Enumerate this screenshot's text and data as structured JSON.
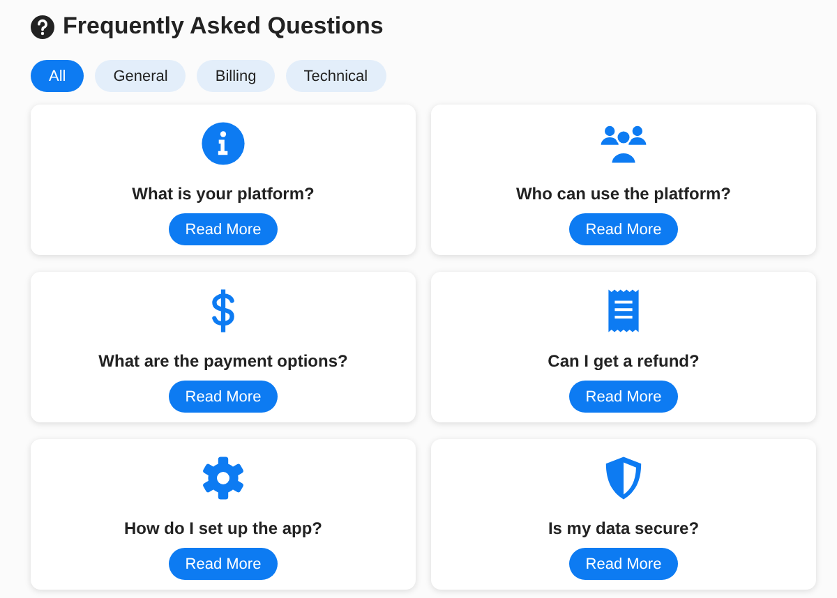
{
  "title": "Frequently Asked Questions",
  "filters": [
    {
      "label": "All",
      "selected": true
    },
    {
      "label": "General",
      "selected": false
    },
    {
      "label": "Billing",
      "selected": false
    },
    {
      "label": "Technical",
      "selected": false
    }
  ],
  "faqs": [
    {
      "kind": "info",
      "question": "What is your platform?",
      "button": "Read More"
    },
    {
      "kind": "users",
      "question": "Who can use the platform?",
      "button": "Read More"
    },
    {
      "kind": "dollar",
      "question": "What are the payment options?",
      "button": "Read More"
    },
    {
      "kind": "receipt",
      "question": "Can I get a refund?",
      "button": "Read More"
    },
    {
      "kind": "gear",
      "question": "How do I set up the app?",
      "button": "Read More"
    },
    {
      "kind": "shield",
      "question": "Is my data secure?",
      "button": "Read More"
    }
  ]
}
